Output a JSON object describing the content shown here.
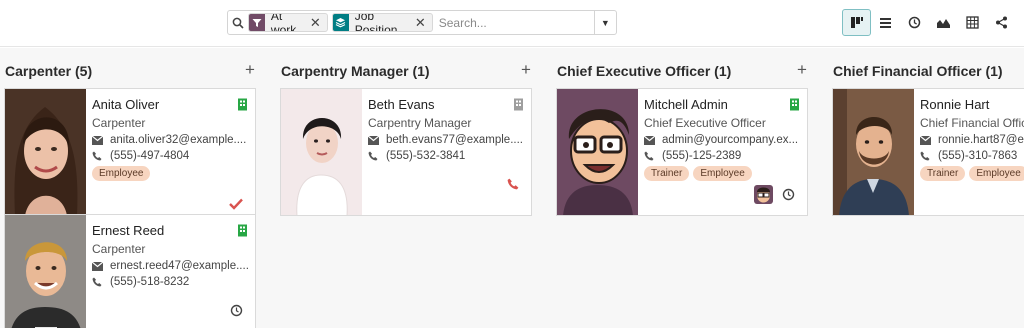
{
  "search": {
    "facets": [
      {
        "type": "filter",
        "icon": "filter-icon",
        "label": "At work"
      },
      {
        "type": "group",
        "icon": "layers-icon",
        "label": "Job Position"
      }
    ],
    "placeholder": "Search..."
  },
  "view_switcher": [
    "kanban-view",
    "list-view",
    "activity-view",
    "graph-view",
    "pivot-view",
    "hierarchy-view"
  ],
  "colors": {
    "filter_facet": "#714b67",
    "group_facet": "#017e84",
    "tag_bg": "#f7d5c0",
    "building_present": "#28a745",
    "building_absent": "#9e9e9e",
    "check": "#d9534f",
    "phone_red": "#d9534f",
    "active_view": "#e6f2f3"
  },
  "columns": [
    {
      "title": "Carpenter (5)",
      "cards": [
        {
          "name": "Anita Oliver",
          "job": "Carpenter",
          "email": "anita.oliver32@example....",
          "phone": "(555)-497-4804",
          "tags": [
            "Employee"
          ],
          "presence": "present",
          "status": "check-icon"
        },
        {
          "name": "Ernest Reed",
          "job": "Carpenter",
          "email": "ernest.reed47@example....",
          "phone": "(555)-518-8232",
          "tags": [],
          "presence": "present",
          "status": "clock-icon"
        }
      ]
    },
    {
      "title": "Carpentry Manager (1)",
      "cards": [
        {
          "name": "Beth Evans",
          "job": "Carpentry Manager",
          "email": "beth.evans77@example....",
          "phone": "(555)-532-3841",
          "tags": [],
          "presence": "absent",
          "status": "phone-icon"
        }
      ]
    },
    {
      "title": "Chief Executive Officer (1)",
      "cards": [
        {
          "name": "Mitchell Admin",
          "job": "Chief Executive Officer",
          "email": "admin@yourcompany.ex...",
          "phone": "(555)-125-2389",
          "tags": [
            "Trainer",
            "Employee"
          ],
          "presence": "present",
          "status": "clock-icon"
        }
      ]
    },
    {
      "title": "Chief Financial Officer (1)",
      "cards": [
        {
          "name": "Ronnie Hart",
          "job": "Chief Financial Officer",
          "email": "ronnie.hart87@e",
          "phone": "(555)-310-7863",
          "tags": [
            "Trainer",
            "Employee"
          ],
          "presence": "absent",
          "status": ""
        }
      ]
    }
  ]
}
